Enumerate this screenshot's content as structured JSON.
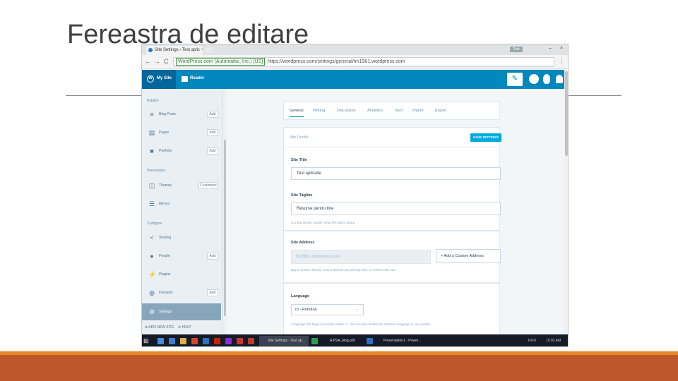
{
  "slide": {
    "title": "Fereastra de editare",
    "colors": {
      "band": "#c0562b",
      "band_top": "#e8862a",
      "title": "#404040"
    }
  },
  "browser": {
    "tab_title": "Site Settings ‹ Test aplic",
    "tab_close": "×",
    "user_badge": "Test",
    "win_min": "–",
    "win_close": "×",
    "back": "←",
    "forward": "→",
    "reload": "C",
    "secure_label": "WordPress.com (Automattic, Inc.) [US]",
    "url": "https://wordpress.com/settings/general/tm1961.wordpress.com",
    "menu": "⋮"
  },
  "masterbar": {
    "my_site": "My Site",
    "reader": "Reader",
    "wp_logo_glyph": "W",
    "write_icon": "✎",
    "color": "#0087be"
  },
  "sidebar": {
    "publish_heading": "Publish",
    "personalize_heading": "Personalize",
    "configure_heading": "Configure",
    "items": [
      {
        "label": "Blog Posts",
        "icon": "≡",
        "action": "Add"
      },
      {
        "label": "Pages",
        "icon": "▤",
        "action": "Add"
      },
      {
        "label": "Portfolio",
        "icon": "■",
        "action": "Add"
      },
      {
        "label": "Themes",
        "icon": "◫",
        "action": "Customize"
      },
      {
        "label": "Menus",
        "icon": "☰",
        "action": ""
      },
      {
        "label": "Sharing",
        "icon": "<",
        "action": ""
      },
      {
        "label": "People",
        "icon": "●",
        "action": "Add"
      },
      {
        "label": "Plugins",
        "icon": "⚡",
        "action": ""
      },
      {
        "label": "Domains",
        "icon": "◍",
        "action": "Add"
      },
      {
        "label": "Settings",
        "icon": "⚙",
        "action": ""
      }
    ],
    "add_new_site": "⊕ ADD NEW SITE",
    "help": "⊘ HELP"
  },
  "settings": {
    "tabs": [
      "General",
      "Writing",
      "Discussion",
      "Analytics",
      "SEO",
      "Import",
      "Export"
    ],
    "active_tab": "General",
    "profile_heading": "Site Profile",
    "save_button": "SAVE SETTINGS",
    "site_title_label": "Site Title",
    "site_title_value": "Test aplicatie",
    "tagline_label": "Site Tagline",
    "tagline_value": "Resurse pentru tine",
    "tagline_help": "In a few words, explain what this site is about.",
    "address_label": "Site Address",
    "address_value": "tm1961.wordpress.com",
    "add_domain_button": "Add a Custom Address",
    "address_help": "Buy a custom domain, map a domain you already own, or redirect this site.",
    "language_label": "Language",
    "language_value": "ro - Română",
    "language_help": "Language this blog is primarily written in. You can also modify the interface language in your profile."
  },
  "taskbar": {
    "windows": [
      {
        "label": "Site Settings ‹ Test ap…"
      },
      {
        "label": "A  PSA_blog.pdf"
      },
      {
        "label": "Presentation1 - Power…"
      }
    ],
    "right": "ROU",
    "time": "10:02 AM"
  }
}
